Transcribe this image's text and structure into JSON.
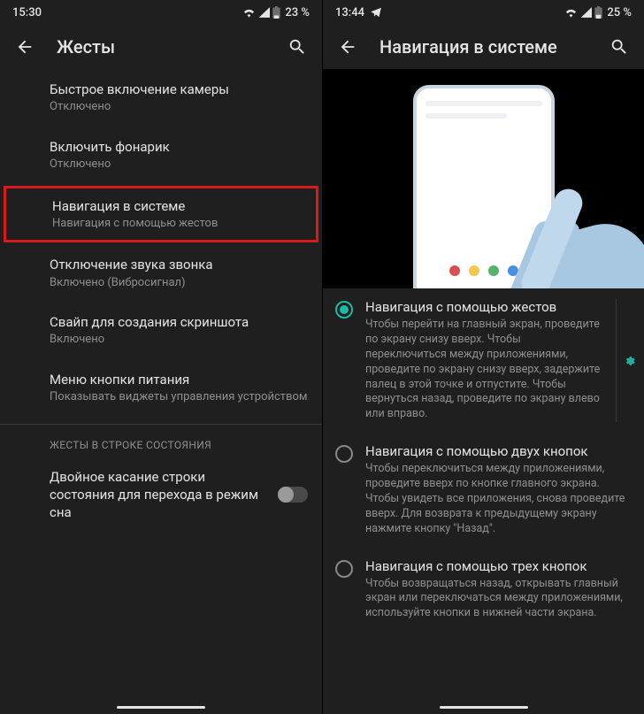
{
  "s1": {
    "status": {
      "time": "15:30",
      "battery": "23 %"
    },
    "header": {
      "title": "Жесты"
    },
    "items": [
      {
        "title": "Быстрое включение камеры",
        "subtitle": "Отключено"
      },
      {
        "title": "Включить фонарик",
        "subtitle": "Отключено"
      },
      {
        "title": "Навигация в системе",
        "subtitle": "Навигация с помощью жестов"
      },
      {
        "title": "Отключение звука звонка",
        "subtitle": "Включено (Вибросигнал)"
      },
      {
        "title": "Свайп для создания скриншота",
        "subtitle": "Включено"
      },
      {
        "title": "Меню кнопки питания",
        "subtitle": "Показывать виджеты управления устройством"
      }
    ],
    "section_header": "ЖЕСТЫ В СТРОКЕ СОСТОЯНИЯ",
    "toggle": {
      "title": "Двойное касание строки состояния для перехода в режим сна"
    }
  },
  "s2": {
    "status": {
      "time": "13:44",
      "battery": "25 %"
    },
    "header": {
      "title": "Навигация в системе"
    },
    "options": [
      {
        "title": "Навигация с помощью жестов",
        "desc": "Чтобы перейти на главный экран, проведите по экрану снизу вверх. Чтобы переключиться между приложениями, проведите по экрану снизу вверх, задержите палец в этой точке и отпустите. Чтобы вернуться назад, проведите по экрану влево или вправо.",
        "selected": true,
        "gear": true
      },
      {
        "title": "Навигация с помощью двух кнопок",
        "desc": "Чтобы переключиться между приложениями, проведите вверх по кнопке главного экрана. Чтобы увидеть все приложения, снова проведите вверх. Для возврата к предыдущему экрану нажмите кнопку \"Назад\".",
        "selected": false,
        "gear": false
      },
      {
        "title": "Навигация с помощью трех кнопок",
        "desc": "Чтобы возвращаться назад, открывать главный экран или переключаться между приложениями, используйте кнопки в нижней части экрана.",
        "selected": false,
        "gear": false
      }
    ],
    "illustration": {
      "dot_colors": [
        "#d94f4f",
        "#f2c94c",
        "#58b368",
        "#4a90e2"
      ]
    }
  }
}
